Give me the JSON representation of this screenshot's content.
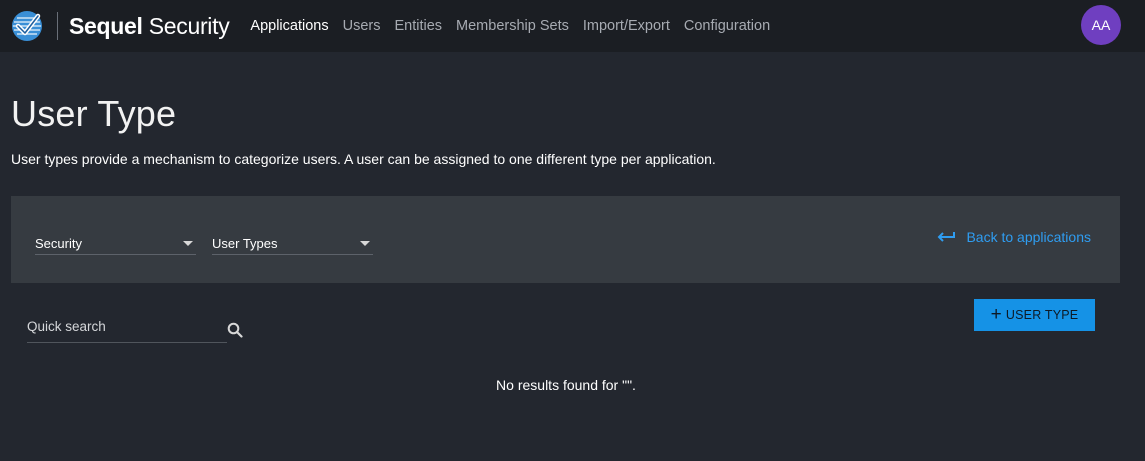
{
  "header": {
    "brand_bold": "Sequel",
    "brand_light": "Security",
    "nav": [
      {
        "label": "Applications",
        "active": true
      },
      {
        "label": "Users",
        "active": false
      },
      {
        "label": "Entities",
        "active": false
      },
      {
        "label": "Membership Sets",
        "active": false
      },
      {
        "label": "Import/Export",
        "active": false
      },
      {
        "label": "Configuration",
        "active": false
      }
    ],
    "avatar_initials": "AA"
  },
  "page": {
    "title": "User Type",
    "description": "User types provide a mechanism to categorize users. A user can be assigned to one different type per application."
  },
  "filters": {
    "application_value": "Security",
    "module_value": "User Types",
    "back_label": "Back to applications"
  },
  "search": {
    "placeholder": "Quick search"
  },
  "actions": {
    "add_label": "USER TYPE"
  },
  "results": {
    "empty_message": "No results found for \"\"."
  },
  "colors": {
    "accent": "#1592e6",
    "link": "#2f9df1",
    "avatar": "#6f3fc0",
    "background": "#23272f",
    "panel": "#363b41"
  }
}
